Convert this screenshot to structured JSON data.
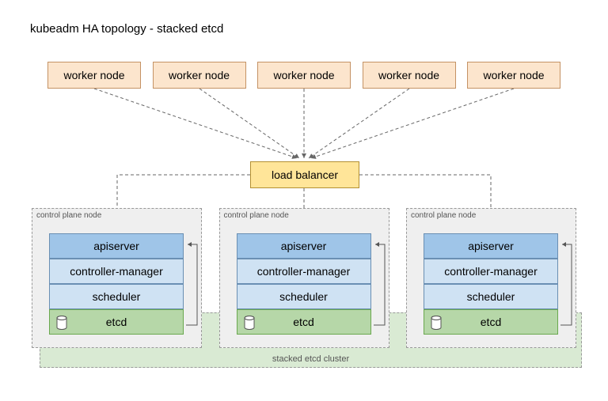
{
  "title": "kubeadm HA topology - stacked etcd",
  "workers": [
    "worker node",
    "worker node",
    "worker node",
    "worker node",
    "worker node"
  ],
  "load_balancer": "load balancer",
  "control_plane": {
    "node_label": "control plane node",
    "components": {
      "apiserver": "apiserver",
      "controller_manager": "controller-manager",
      "scheduler": "scheduler",
      "etcd": "etcd"
    }
  },
  "etcd_cluster_label": "stacked etcd cluster",
  "colors": {
    "worker_bg": "#fce5cd",
    "lb_bg": "#ffe599",
    "api_bg": "#9fc5e8",
    "comp_bg": "#cfe2f3",
    "etcd_bg": "#b6d7a8",
    "cluster_bg": "#d9ead3",
    "cp_bg": "#efefef"
  }
}
